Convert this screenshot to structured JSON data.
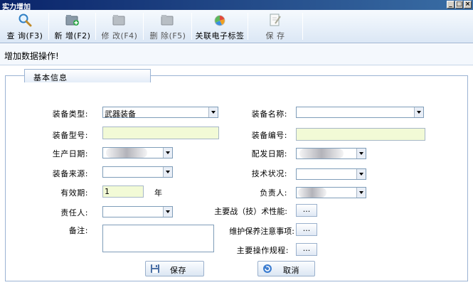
{
  "window": {
    "title": "实力增加",
    "controls": [
      "_",
      "□",
      "×"
    ]
  },
  "toolbar": {
    "query_label": "查 询(F3)",
    "add_label": "新 增(F2)",
    "edit_label": "修 改(F4)",
    "delete_label": "删 除(F5)",
    "link_tag_label": "关联电子标签",
    "save_label": "保  存"
  },
  "status": {
    "operation_text": "增加数据操作!"
  },
  "group": {
    "title": "基本信息"
  },
  "form": {
    "equip_type": {
      "label": "装备类型:",
      "value": "武器装备"
    },
    "equip_model": {
      "label": "装备型号:",
      "value": ""
    },
    "production_date": {
      "label": "生产日期:",
      "value": ""
    },
    "equip_source": {
      "label": "装备来源:",
      "value": ""
    },
    "validity": {
      "label": "有效期:",
      "value": "1",
      "unit": "年"
    },
    "responsible": {
      "label": "责任人:",
      "value": ""
    },
    "remarks": {
      "label": "备注:",
      "value": ""
    },
    "equip_name": {
      "label": "装备名称:",
      "value": ""
    },
    "equip_number": {
      "label": "装备编号:",
      "value": ""
    },
    "issue_date": {
      "label": "配发日期:",
      "value": ""
    },
    "tech_status": {
      "label": "技术状况:",
      "value": ""
    },
    "person_in_charge": {
      "label": "负责人:",
      "value": ""
    },
    "main_performance": {
      "label": "主要战（技）术性能:",
      "button": "..."
    },
    "maintenance_notes": {
      "label": "维护保养注意事项:",
      "button": "..."
    },
    "operation_rules": {
      "label": "主要操作规程:",
      "button": "..."
    }
  },
  "actions": {
    "save_label": "保存",
    "cancel_label": "取消"
  },
  "colors": {
    "required_field_bg": "#f2fad6",
    "title_bar": "#0a246a",
    "toolbar_bg": "#dbe7f5"
  }
}
